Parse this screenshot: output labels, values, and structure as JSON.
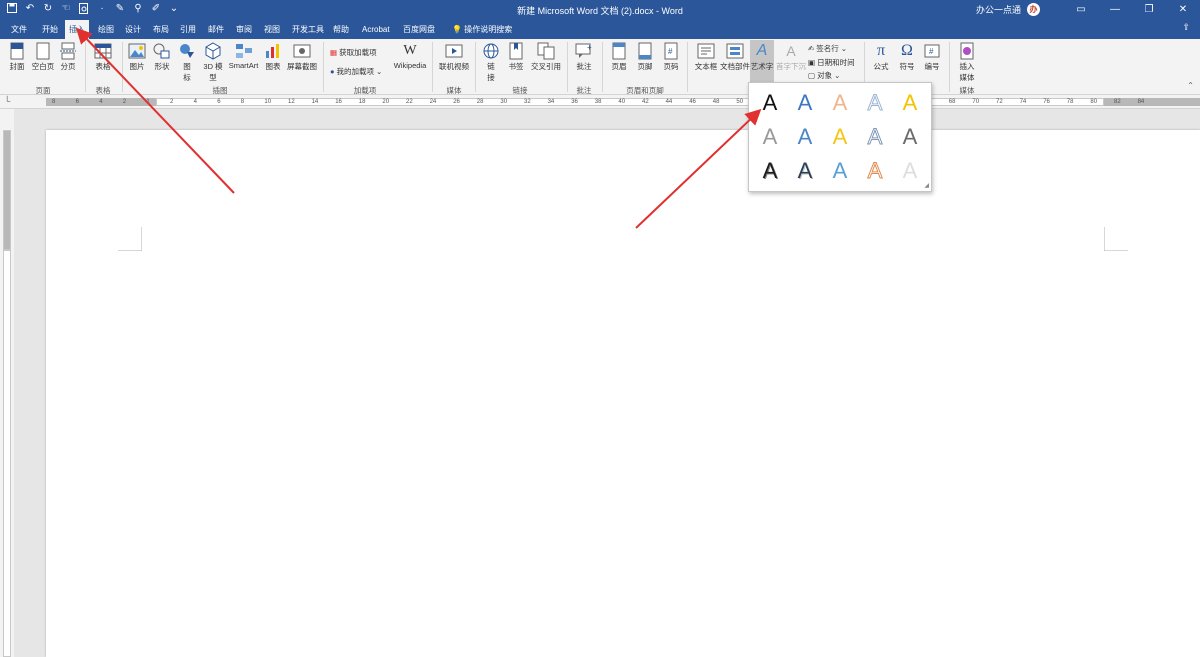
{
  "titlebar": {
    "doc_title": "新建 Microsoft Word 文档 (2).docx - Word",
    "user_name": "办公一点通",
    "avatar_text": "办",
    "qat_icons": [
      "save-icon",
      "undo-icon",
      "redo-icon",
      "touch-icon",
      "print-preview-icon",
      "dash",
      "shape-icon",
      "format-painter-icon",
      "draw-icon",
      "customize-icon"
    ],
    "window_controls": [
      "ribbon-options-icon",
      "minimize-icon",
      "restore-icon",
      "close-icon"
    ]
  },
  "tabs": {
    "file": "文件",
    "home": "开始",
    "insert": "插入",
    "draw": "绘图",
    "design": "设计",
    "layout": "布局",
    "references": "引用",
    "mailings": "邮件",
    "review": "审阅",
    "view": "视图",
    "developer": "开发工具",
    "help": "帮助",
    "acrobat": "Acrobat",
    "baidu": "百度网盘",
    "tellme": "操作说明搜索"
  },
  "ribbon": {
    "cover": "封面",
    "blank_page": "空白页",
    "page_break": "分页",
    "table": "表格",
    "picture": "图片",
    "shapes": "形状",
    "icons1": "图",
    "icons2": "标",
    "model3d1": "3D 模",
    "model3d2": "型",
    "smartart": "SmartArt",
    "chart": "图表",
    "screenshot": "屏幕截图",
    "get_addins": "获取加载项",
    "my_addins": "我的加载项",
    "wikipedia": "Wikipedia",
    "online_video": "联机视频",
    "link1": "链",
    "link2": "接",
    "bookmark": "书签",
    "cross_ref": "交叉引用",
    "comment": "批注",
    "header": "页眉",
    "footer": "页脚",
    "page_number": "页码",
    "textbox": "文本框",
    "quick_parts": "文档部件",
    "wordart": "艺术字",
    "dropcap": "首字下沉",
    "signature": "签名行",
    "datetime": "日期和时间",
    "object": "对象",
    "equation": "公式",
    "symbol": "符号",
    "number": "编号",
    "insert_media1": "插入",
    "insert_media2": "媒体",
    "groups": {
      "pages": "页面",
      "tables": "表格",
      "illustrations": "插图",
      "addins": "加载项",
      "media": "媒体",
      "links": "链接",
      "comments": "批注",
      "header_footer": "页眉和页脚",
      "media2": "媒体"
    }
  },
  "ruler": {
    "h_ticks": [
      "8",
      "6",
      "4",
      "2",
      "1",
      "2",
      "4",
      "6",
      "8",
      "10",
      "12",
      "14",
      "16",
      "18",
      "20",
      "22",
      "24",
      "26",
      "28",
      "30",
      "32",
      "34",
      "36",
      "38",
      "40",
      "42",
      "44",
      "46",
      "48",
      "50",
      "52",
      "54",
      "56",
      "58",
      "60",
      "62",
      "64",
      "66",
      "68",
      "70",
      "72",
      "74",
      "76",
      "78",
      "80",
      "82",
      "84"
    ]
  },
  "wordart_gallery": {
    "glyph": "A",
    "styles": [
      {
        "name": "wordart-style-1",
        "color": "#111111",
        "outline": "none"
      },
      {
        "name": "wordart-style-2",
        "color": "#3d78c2",
        "outline": "none"
      },
      {
        "name": "wordart-style-3",
        "color": "#f1b48c",
        "outline": "none"
      },
      {
        "name": "wordart-style-4",
        "color": "#ffffff",
        "outline": "#9cb4d4"
      },
      {
        "name": "wordart-style-5",
        "color": "#f2c300",
        "outline": "none"
      },
      {
        "name": "wordart-style-6",
        "color": "#9a9a9a",
        "outline": "none"
      },
      {
        "name": "wordart-style-7",
        "color": "#4a86c8",
        "outline": "none"
      },
      {
        "name": "wordart-style-8",
        "color": "#f5c518",
        "outline": "none"
      },
      {
        "name": "wordart-style-9",
        "color": "#ffffff",
        "outline": "#7f97b8"
      },
      {
        "name": "wordart-style-10",
        "color": "#6b6b6b",
        "outline": "none"
      },
      {
        "name": "wordart-style-11",
        "color": "#1c1c1c",
        "outline": "none"
      },
      {
        "name": "wordart-style-12",
        "color": "#2b3f58",
        "outline": "none"
      },
      {
        "name": "wordart-style-13",
        "color": "#5aa0d8",
        "outline": "none"
      },
      {
        "name": "wordart-style-14",
        "color": "#ffffff",
        "outline": "#e08a4e"
      },
      {
        "name": "wordart-style-15",
        "color": "#dedede",
        "outline": "none"
      }
    ]
  },
  "annotation_color": "#e0302f"
}
